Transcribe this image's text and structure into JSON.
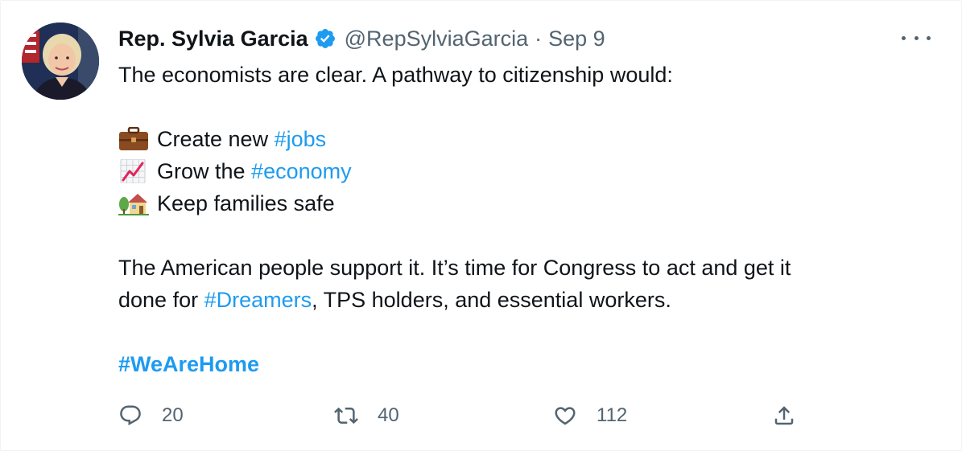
{
  "tweet": {
    "author": {
      "display_name": "Rep. Sylvia Garcia",
      "handle": "@RepSylviaGarcia",
      "verified": true,
      "avatar_icon": "avatar-photo"
    },
    "separator": "·",
    "timestamp": "Sep 9",
    "body": {
      "intro": "The economists are clear. A pathway to citizenship would:",
      "bullets": [
        {
          "icon": "briefcase-icon",
          "text": "Create new ",
          "hashtag": "#jobs"
        },
        {
          "icon": "chart-increasing-icon",
          "text": "Grow the ",
          "hashtag": "#economy"
        },
        {
          "icon": "house-with-garden-icon",
          "text": "Keep families safe"
        }
      ],
      "paragraph_line1": "The American people support it. It’s time for Congress to act and get it",
      "paragraph_line2_prefix": "done for ",
      "paragraph_line2_hashtag": "#Dreamers",
      "paragraph_line2_suffix": ", TPS holders, and essential workers.",
      "closing_hashtag": "#WeAreHome"
    },
    "actions": {
      "reply": {
        "icon": "reply-icon",
        "count": "20"
      },
      "retweet": {
        "icon": "retweet-icon",
        "count": "40"
      },
      "like": {
        "icon": "heart-icon",
        "count": "112"
      },
      "share": {
        "icon": "share-icon"
      }
    },
    "more_icon": "more-options-icon",
    "colors": {
      "link": "#1d9bf0",
      "secondary_text": "#536471",
      "primary_text": "#0f1419",
      "verified_badge": "#1d9bf0"
    }
  }
}
